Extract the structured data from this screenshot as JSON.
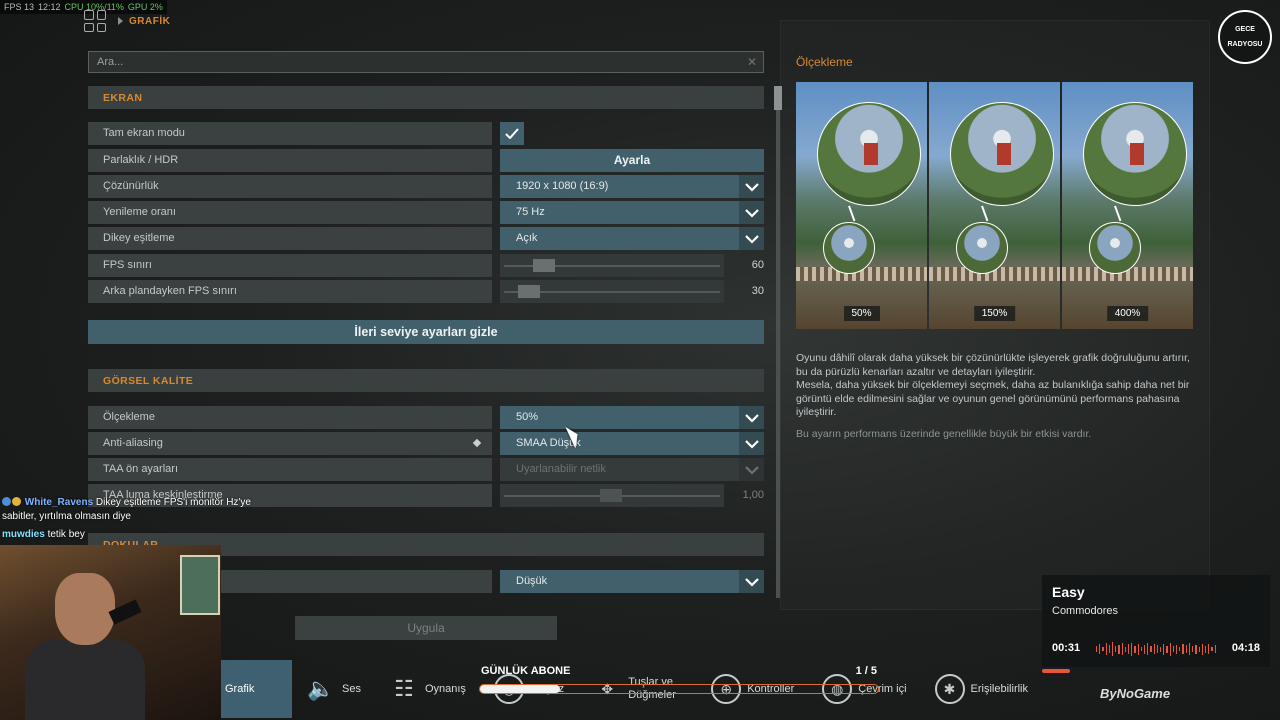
{
  "overlay": {
    "fps": "FPS 13",
    "time": "12:12",
    "cpu": "CPU 10%/11%",
    "gpu": "GPU 2%"
  },
  "header": {
    "breadcrumb": "GRAFİK"
  },
  "search": {
    "placeholder": "Ara..."
  },
  "sections": {
    "ekran": "EKRAN",
    "gorsel": "GÖRSEL KALİTE",
    "dokular": "DOKULAR"
  },
  "rows": {
    "fullscreen": "Tam ekran modu",
    "brightness": "Parlaklık / HDR",
    "brightness_btn": "Ayarla",
    "resolution": "Çözünürlük",
    "resolution_val": "1920 x 1080 (16:9)",
    "refresh": "Yenileme oranı",
    "refresh_val": "75 Hz",
    "vsync": "Dikey eşitleme",
    "vsync_val": "Açık",
    "fps_limit": "FPS sınırı",
    "fps_limit_val": "60",
    "bg_fps_limit": "Arka plandayken FPS sınırı",
    "bg_fps_limit_val": "30",
    "advanced_btn": "İleri seviye ayarları gizle",
    "scaling": "Ölçekleme",
    "scaling_val": "50%",
    "aa": "Anti-aliasing",
    "aa_val": "SMAA Düşük",
    "taa": "TAA ön ayarları",
    "taa_val": "Uyarlanabilir netlik",
    "taa_sharp": "TAA luma keskinleştirme",
    "taa_sharp_val": "1,00",
    "texture_val": "Düşük"
  },
  "apply_btn": "Uygula",
  "right": {
    "title": "Ölçekleme",
    "preview_labels": [
      "50%",
      "150%",
      "400%"
    ],
    "desc1": "Oyunu dâhilî olarak daha yüksek bir çözünürlükte işleyerek grafik doğruluğunu artırır, bu da pürüzlü kenarları azaltır ve detayları iyileştirir.",
    "desc2": "Mesela, daha yüksek bir ölçeklemeyi seçmek, daha az bulanıklığa sahip daha net bir görüntü elde edilmesini sağlar ve oyunun genel görünümünü performans pahasına iyileştirir.",
    "note": "Bu ayarın performans üzerinde genellikle büyük bir etkisi vardır."
  },
  "logo": {
    "top": "GECE",
    "bottom": "RADYOSU"
  },
  "chat": [
    {
      "user": "White_Ravens",
      "msg": "Dikey eşitleme FPS'i monitör Hz'ye sabitler, yırtılma olmasın diye"
    },
    {
      "user": "muwdies",
      "msg": "tetik bey"
    }
  ],
  "nav": {
    "grafik": "Grafik",
    "ses": "Ses",
    "oynanis": "Oynanış",
    "arayuz": "Arayüz",
    "tuslar": "Tuşlar ve Düğmeler",
    "kontroller": "Kontroller",
    "cevrimici": "Çevrim içi",
    "erisilebilirlik": "Erişilebilirlik"
  },
  "subgoal": {
    "title": "GÜNLÜK ABONE",
    "count": "1 / 5",
    "progress": 0.2
  },
  "music": {
    "track": "Easy",
    "artist": "Commodores",
    "elapsed": "00:31",
    "total": "04:18"
  },
  "watermark": "ByNoGame",
  "colors": {
    "accent": "#d8892f",
    "control": "#42606b",
    "row": "#3b4040"
  }
}
